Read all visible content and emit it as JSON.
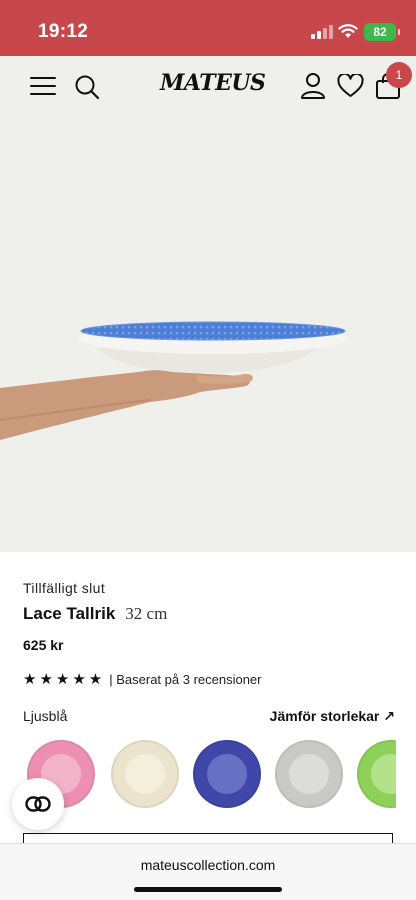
{
  "status_bar": {
    "time": "19:12",
    "battery": "82"
  },
  "header": {
    "logo": "MATEUS",
    "cart_count": "1",
    "icons": [
      "menu-icon",
      "search-icon",
      "user-icon",
      "heart-icon",
      "shopping-bag-icon"
    ]
  },
  "gallery": {
    "image_count": 3,
    "active_index": 1
  },
  "product": {
    "availability": "Tillfälligt slut",
    "name": "Lace Tallrik",
    "size": "32 cm",
    "price": "625 kr",
    "rating_stars": 5,
    "stars": "★★★★★",
    "reviews_text": "| Baserat på 3 recensioner",
    "color_label": "Ljusblå",
    "compare_link": "Jämför storlekar ↗"
  },
  "swatches": [
    {
      "name": "pink",
      "color": "#ec8fb0",
      "inner": "#f3b3c9"
    },
    {
      "name": "cream",
      "color": "#ebe3cc",
      "inner": "#f4eedc"
    },
    {
      "name": "blue",
      "color": "#3f47a8",
      "inner": "#6870c4"
    },
    {
      "name": "grey",
      "color": "#c9c9c6",
      "inner": "#dcdcda"
    },
    {
      "name": "lime",
      "color": "#8fd05a",
      "inner": "#b3e28a"
    }
  ],
  "colors": {
    "brand_red": "#c8474b",
    "background": "#efefec",
    "plate_blue": "#4d7fd6"
  },
  "browser": {
    "url": "mateuscollection.com"
  }
}
